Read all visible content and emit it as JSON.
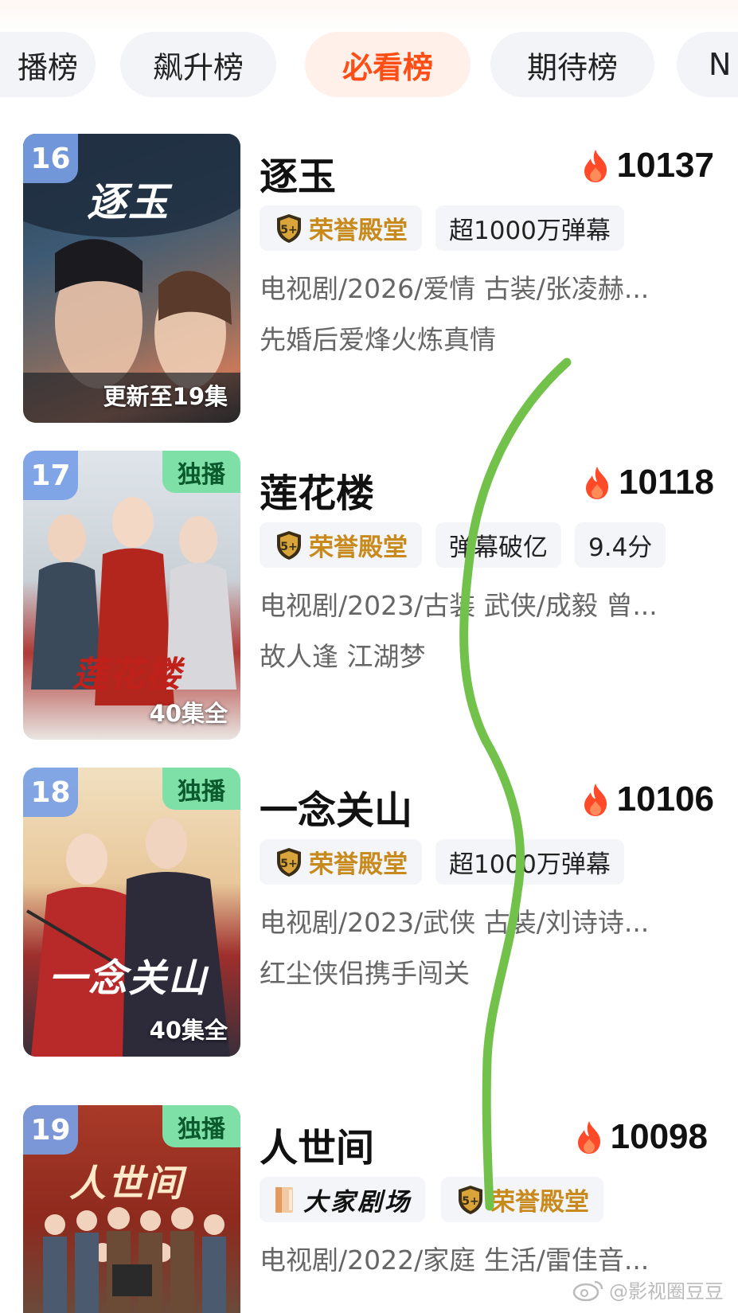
{
  "tabs": [
    {
      "label": "播榜",
      "active": false
    },
    {
      "label": "飙升榜",
      "active": false
    },
    {
      "label": "必看榜",
      "active": true
    },
    {
      "label": "期待榜",
      "active": false
    },
    {
      "label": "N",
      "active": false
    }
  ],
  "colors": {
    "accent": "#ff4d16",
    "honor": "#c88a1c",
    "exclusive_bg": "#7ee0a6",
    "rank_bg": "#78a0e6",
    "scribble": "#72c14a"
  },
  "items": [
    {
      "rank": "16",
      "exclusive": "",
      "episodes": "更新至19集",
      "poster_art_text": "逐玉",
      "title": "逐玉",
      "heat": "10137",
      "tags": [
        {
          "text": "荣誉殿堂",
          "kind": "honor"
        },
        {
          "text": "超1000万弹幕",
          "kind": "plain"
        }
      ],
      "meta": "电视剧/2026/爱情 古装/张凌赫...",
      "slogan": "先婚后爱烽火炼真情"
    },
    {
      "rank": "17",
      "exclusive": "独播",
      "episodes": "40集全",
      "poster_art_text": "莲花楼",
      "title": "莲花楼",
      "heat": "10118",
      "tags": [
        {
          "text": "荣誉殿堂",
          "kind": "honor"
        },
        {
          "text": "弹幕破亿",
          "kind": "plain"
        },
        {
          "text": "9.4分",
          "kind": "plain"
        }
      ],
      "meta": "电视剧/2023/古装 武侠/成毅 曾...",
      "slogan": "故人逢 江湖梦"
    },
    {
      "rank": "18",
      "exclusive": "独播",
      "episodes": "40集全",
      "poster_art_text": "一念关山",
      "title": "一念关山",
      "heat": "10106",
      "tags": [
        {
          "text": "荣誉殿堂",
          "kind": "honor"
        },
        {
          "text": "超1000万弹幕",
          "kind": "plain"
        }
      ],
      "meta": "电视剧/2023/武侠 古装/刘诗诗...",
      "slogan": "红尘侠侣携手闯关"
    },
    {
      "rank": "19",
      "exclusive": "独播",
      "episodes": "",
      "poster_art_text": "人世间",
      "title": "人世间",
      "heat": "10098",
      "tags": [
        {
          "text": "大家剧场",
          "kind": "theater"
        },
        {
          "text": "荣誉殿堂",
          "kind": "honor"
        }
      ],
      "meta": "电视剧/2022/家庭 生活/雷佳音...",
      "slogan": ""
    }
  ],
  "watermark": "@影视圈豆豆"
}
